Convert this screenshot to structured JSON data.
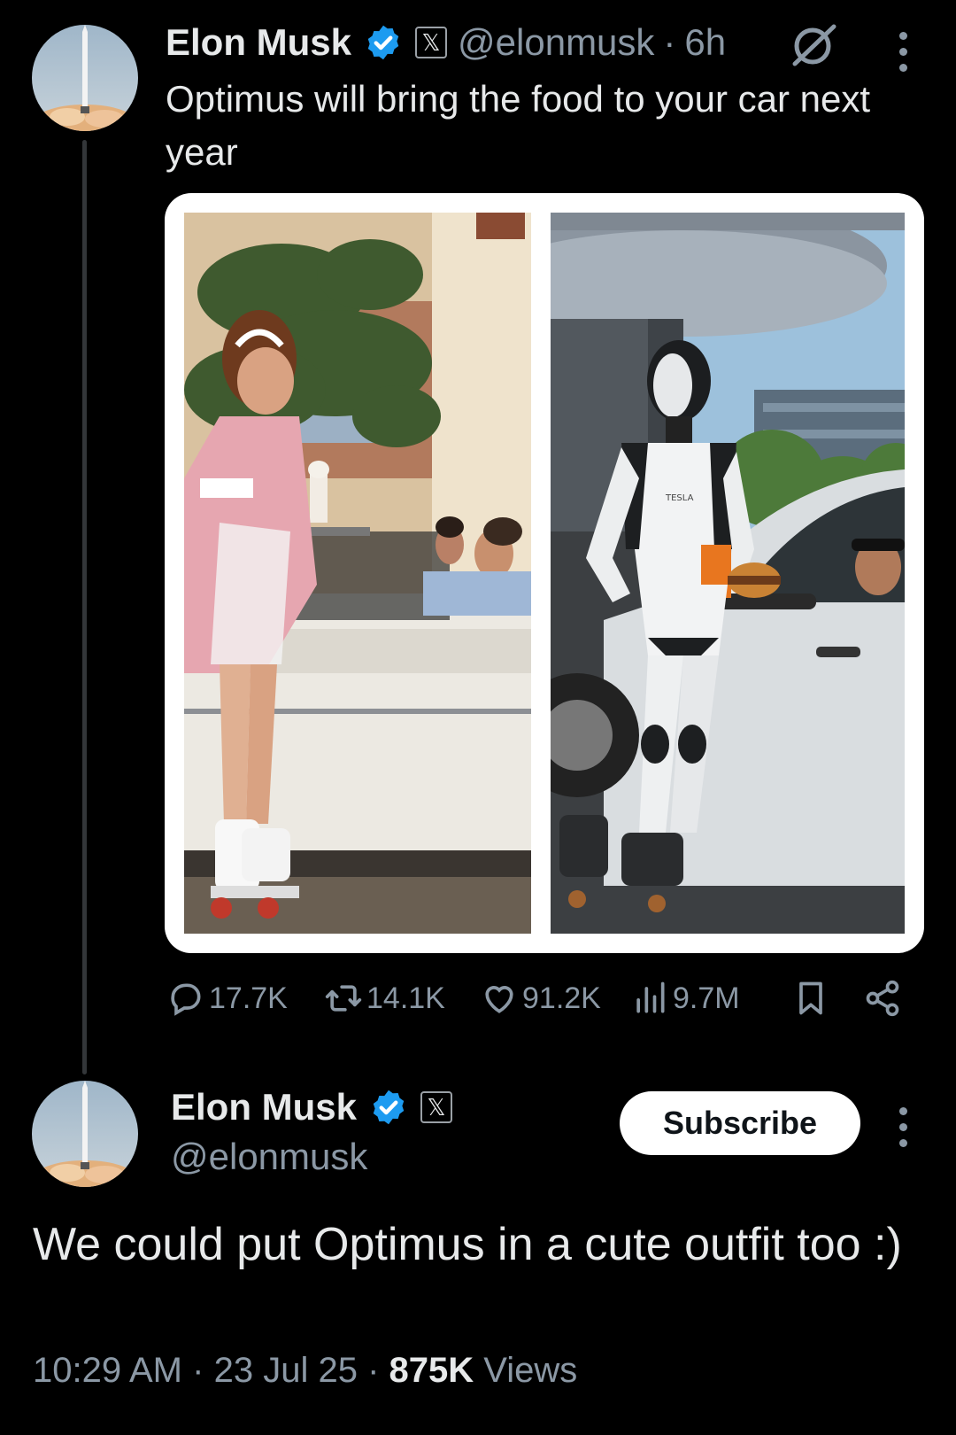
{
  "parent_post": {
    "author_name": "Elon Musk",
    "handle": "@elonmusk",
    "separator": "·",
    "time_ago": "6h",
    "text": "Optimus will bring the food to your car next year",
    "badge_icon": "verified-badge-icon",
    "affiliate_icon": "x-affiliate-icon",
    "robot_logo_text": "TESLA",
    "stats": {
      "replies": "17.7K",
      "reposts": "14.1K",
      "likes": "91.2K",
      "views": "9.7M"
    }
  },
  "reply_post": {
    "author_name": "Elon Musk",
    "handle": "@elonmusk",
    "subscribe_label": "Subscribe",
    "text": "We could put Optimus in a cute outfit too :)",
    "time": "10:29 AM",
    "separator": "·",
    "date": "23 Jul 25",
    "views_count": "875K",
    "views_label": "Views"
  },
  "colors": {
    "background": "#000000",
    "verified_blue": "#1d9bf0",
    "secondary_text": "#8b98a5",
    "primary_text": "#e7e9ea"
  }
}
